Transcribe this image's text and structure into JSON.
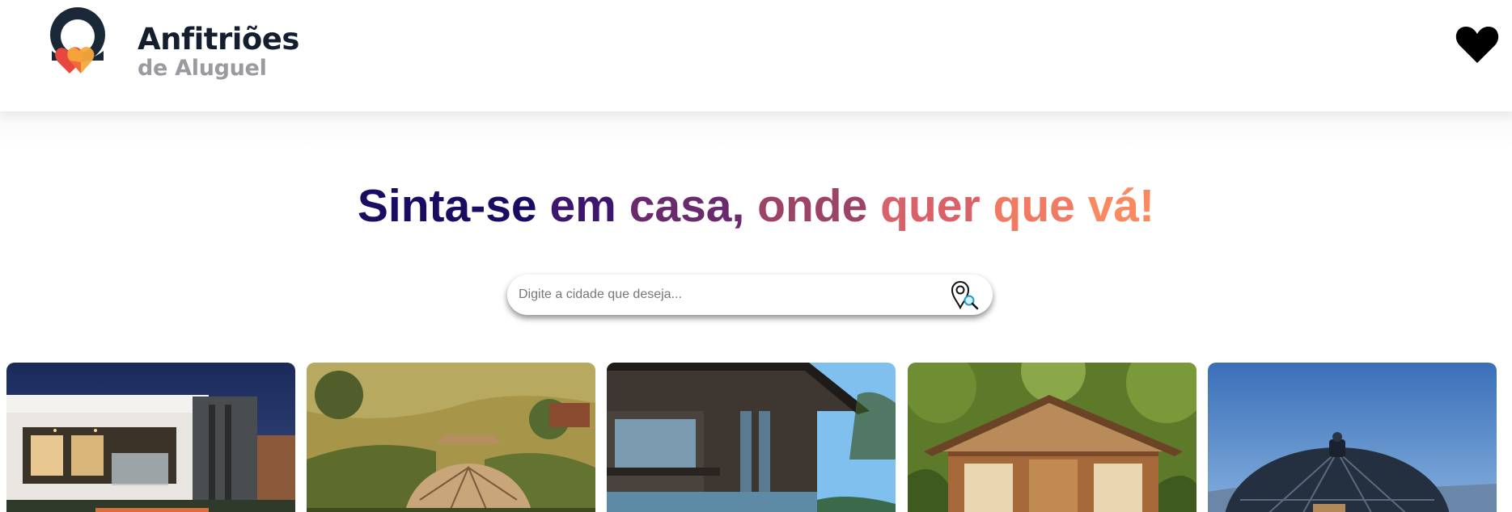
{
  "header": {
    "brand_line1": "Anfitriões",
    "brand_line2": "de Aluguel",
    "logo_icon": "house-heart-logo",
    "favorites_icon": "heart-icon"
  },
  "hero": {
    "headline_words": [
      {
        "text": "Sinta-se",
        "color": "#1a0b63"
      },
      {
        "text": "em",
        "color": "#3d176d"
      },
      {
        "text": "casa,",
        "color": "#6a2a6e"
      },
      {
        "text": "onde",
        "color": "#9c4368"
      },
      {
        "text": "quer",
        "color": "#d8616a"
      },
      {
        "text": "que",
        "color": "#f17a63"
      },
      {
        "text": "vá!",
        "color": "#f98a5f"
      }
    ]
  },
  "search": {
    "placeholder": "Digite a cidade que deseja...",
    "value": "",
    "icon": "location-search-icon"
  },
  "cards": [
    {
      "name": "modern-house-night"
    },
    {
      "name": "geodesic-dome-hills"
    },
    {
      "name": "wooden-cabin-blue-sky"
    },
    {
      "name": "tropical-wood-chalet"
    },
    {
      "name": "glass-dome-cabin"
    }
  ]
}
